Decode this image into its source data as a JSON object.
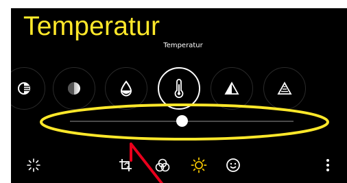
{
  "editor": {
    "overlay_title": "Temperatur",
    "current_tool_label": "Temperatur",
    "tools": [
      {
        "icon": "highlights-icon"
      },
      {
        "icon": "contrast-icon"
      },
      {
        "icon": "saturation-drop-icon"
      },
      {
        "icon": "thermometer-icon",
        "selected": true
      },
      {
        "icon": "tint-triangle-icon"
      },
      {
        "icon": "sharpness-triangle-icon"
      }
    ],
    "slider": {
      "value": 0.5
    },
    "bottom_bar": [
      {
        "icon": "auto-sparkle-icon"
      },
      {
        "icon": "crop-rotate-icon"
      },
      {
        "icon": "filters-icon"
      },
      {
        "icon": "adjust-sun-icon",
        "active": true
      },
      {
        "icon": "sticker-smiley-icon"
      },
      {
        "icon": "more-vert-icon"
      }
    ]
  },
  "colors": {
    "annotation_yellow": "#ffe82a",
    "annotation_red": "#e8001c",
    "active_icon": "#f2c400"
  }
}
